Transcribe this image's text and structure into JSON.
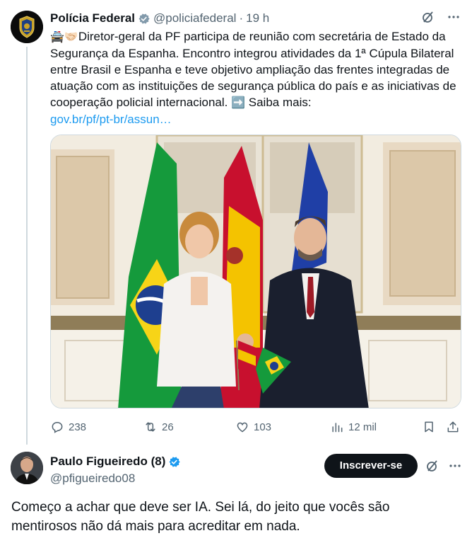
{
  "tweet1": {
    "display_name": "Polícia Federal",
    "handle": "@policiafederal",
    "time": "19 h",
    "text_emoji": "🚔🤝🏻",
    "text": "Diretor-geral da PF participa de reunião com secretária de Estado da Segurança da Espanha. Encontro integrou atividades da 1ª Cúpula Bilateral entre Brasil e Espanha e teve objetivo ampliação das frentes integradas de atuação com as instituições de segurança pública do país e as iniciativas de cooperação policial internacional. ",
    "arrow_emoji": "➡️",
    "saiba": " Saiba mais:",
    "link": "gov.br/pf/pt-br/assun…",
    "stats": {
      "replies": "238",
      "reposts": "26",
      "likes": "103",
      "views": "12 mil"
    }
  },
  "tweet2": {
    "display_name": "Paulo Figueiredo (8)",
    "handle": "@pfigueiredo08",
    "subscribe_label": "Inscrever-se",
    "text": "Começo a achar que deve ser IA. Sei lá, do jeito que vocês são mentirosos não dá mais para acreditar em nada."
  },
  "colors": {
    "link": "#1d9bf0",
    "verified": "#1d9bf0",
    "muted": "#536471",
    "button": "#0f1419"
  },
  "icons": [
    "grok-icon",
    "more-icon",
    "reply-icon",
    "repost-icon",
    "like-icon",
    "views-icon",
    "bookmark-icon",
    "share-icon",
    "verified-icon"
  ]
}
